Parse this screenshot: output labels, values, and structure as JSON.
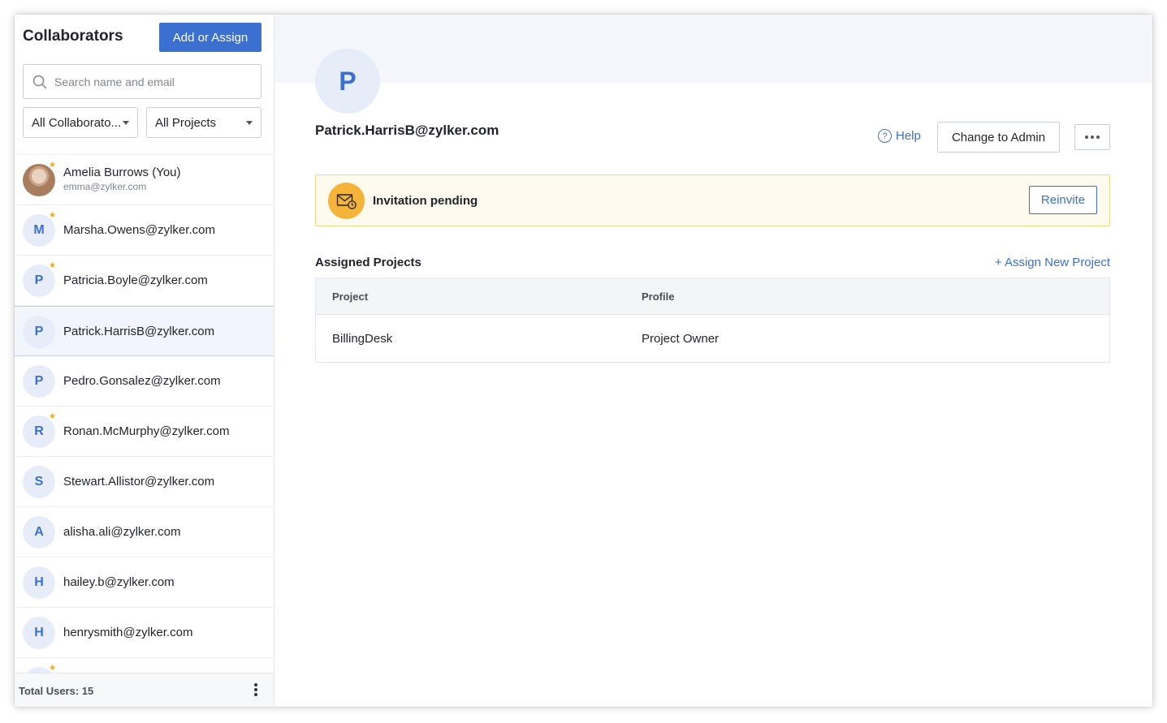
{
  "sidebar": {
    "title": "Collaborators",
    "add_button": "Add or Assign",
    "search_placeholder": "Search name and email",
    "filter_collaborators": "All Collaborato...",
    "filter_projects": "All Projects",
    "users": [
      {
        "initial": "",
        "name": "Amelia Burrows (You)",
        "email": "emma@zylker.com",
        "photo": true,
        "starred": true
      },
      {
        "initial": "M",
        "name": "Marsha.Owens@zylker.com",
        "starred": true
      },
      {
        "initial": "P",
        "name": "Patricia.Boyle@zylker.com",
        "starred": true
      },
      {
        "initial": "P",
        "name": "Patrick.HarrisB@zylker.com",
        "starred": false,
        "selected": true
      },
      {
        "initial": "P",
        "name": "Pedro.Gonsalez@zylker.com",
        "starred": false
      },
      {
        "initial": "R",
        "name": "Ronan.McMurphy@zylker.com",
        "starred": true
      },
      {
        "initial": "S",
        "name": "Stewart.Allistor@zylker.com",
        "starred": false
      },
      {
        "initial": "A",
        "name": "alisha.ali@zylker.com",
        "starred": false
      },
      {
        "initial": "H",
        "name": "hailey.b@zylker.com",
        "starred": false
      },
      {
        "initial": "H",
        "name": "henrysmith@zylker.com",
        "starred": false
      },
      {
        "initial": "",
        "name": "",
        "starred": true
      }
    ],
    "footer_total": "Total Users: 15"
  },
  "detail": {
    "avatar_initial": "P",
    "email": "Patrick.HarrisB@zylker.com",
    "help_label": "Help",
    "change_admin_label": "Change to Admin",
    "invitation_text": "Invitation pending",
    "reinvite_label": "Reinvite",
    "assigned_title": "Assigned Projects",
    "assign_new_label": "+ Assign New Project",
    "table": {
      "headers": [
        "Project",
        "Profile"
      ],
      "rows": [
        [
          "BillingDesk",
          "Project Owner"
        ]
      ]
    }
  },
  "colors": {
    "accent": "#3b6fd0",
    "star": "#f2a81e",
    "invite_bg": "#fefaee",
    "invite_icon": "#f4b43a"
  }
}
